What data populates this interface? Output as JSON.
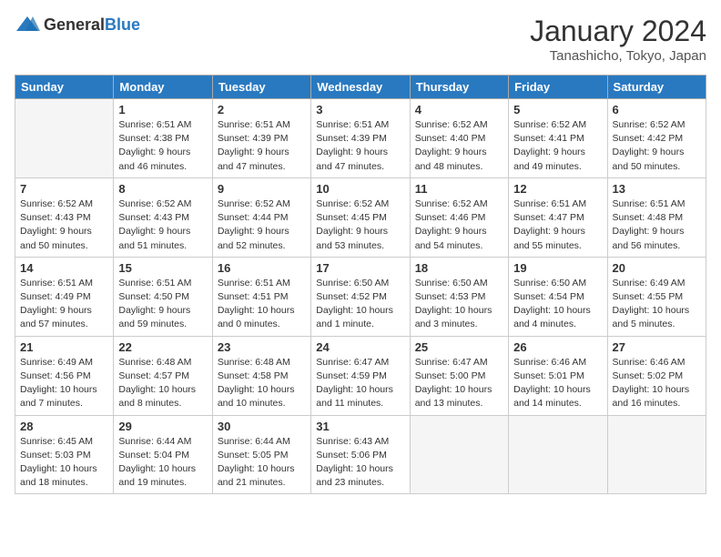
{
  "logo": {
    "general": "General",
    "blue": "Blue"
  },
  "header": {
    "month": "January 2024",
    "location": "Tanashicho, Tokyo, Japan"
  },
  "weekdays": [
    "Sunday",
    "Monday",
    "Tuesday",
    "Wednesday",
    "Thursday",
    "Friday",
    "Saturday"
  ],
  "weeks": [
    [
      {
        "day": "",
        "sunrise": "",
        "sunset": "",
        "daylight": "",
        "empty": true
      },
      {
        "day": "1",
        "sunrise": "Sunrise: 6:51 AM",
        "sunset": "Sunset: 4:38 PM",
        "daylight": "Daylight: 9 hours and 46 minutes."
      },
      {
        "day": "2",
        "sunrise": "Sunrise: 6:51 AM",
        "sunset": "Sunset: 4:39 PM",
        "daylight": "Daylight: 9 hours and 47 minutes."
      },
      {
        "day": "3",
        "sunrise": "Sunrise: 6:51 AM",
        "sunset": "Sunset: 4:39 PM",
        "daylight": "Daylight: 9 hours and 47 minutes."
      },
      {
        "day": "4",
        "sunrise": "Sunrise: 6:52 AM",
        "sunset": "Sunset: 4:40 PM",
        "daylight": "Daylight: 9 hours and 48 minutes."
      },
      {
        "day": "5",
        "sunrise": "Sunrise: 6:52 AM",
        "sunset": "Sunset: 4:41 PM",
        "daylight": "Daylight: 9 hours and 49 minutes."
      },
      {
        "day": "6",
        "sunrise": "Sunrise: 6:52 AM",
        "sunset": "Sunset: 4:42 PM",
        "daylight": "Daylight: 9 hours and 50 minutes."
      }
    ],
    [
      {
        "day": "7",
        "sunrise": "Sunrise: 6:52 AM",
        "sunset": "Sunset: 4:43 PM",
        "daylight": "Daylight: 9 hours and 50 minutes."
      },
      {
        "day": "8",
        "sunrise": "Sunrise: 6:52 AM",
        "sunset": "Sunset: 4:43 PM",
        "daylight": "Daylight: 9 hours and 51 minutes."
      },
      {
        "day": "9",
        "sunrise": "Sunrise: 6:52 AM",
        "sunset": "Sunset: 4:44 PM",
        "daylight": "Daylight: 9 hours and 52 minutes."
      },
      {
        "day": "10",
        "sunrise": "Sunrise: 6:52 AM",
        "sunset": "Sunset: 4:45 PM",
        "daylight": "Daylight: 9 hours and 53 minutes."
      },
      {
        "day": "11",
        "sunrise": "Sunrise: 6:52 AM",
        "sunset": "Sunset: 4:46 PM",
        "daylight": "Daylight: 9 hours and 54 minutes."
      },
      {
        "day": "12",
        "sunrise": "Sunrise: 6:51 AM",
        "sunset": "Sunset: 4:47 PM",
        "daylight": "Daylight: 9 hours and 55 minutes."
      },
      {
        "day": "13",
        "sunrise": "Sunrise: 6:51 AM",
        "sunset": "Sunset: 4:48 PM",
        "daylight": "Daylight: 9 hours and 56 minutes."
      }
    ],
    [
      {
        "day": "14",
        "sunrise": "Sunrise: 6:51 AM",
        "sunset": "Sunset: 4:49 PM",
        "daylight": "Daylight: 9 hours and 57 minutes."
      },
      {
        "day": "15",
        "sunrise": "Sunrise: 6:51 AM",
        "sunset": "Sunset: 4:50 PM",
        "daylight": "Daylight: 9 hours and 59 minutes."
      },
      {
        "day": "16",
        "sunrise": "Sunrise: 6:51 AM",
        "sunset": "Sunset: 4:51 PM",
        "daylight": "Daylight: 10 hours and 0 minutes."
      },
      {
        "day": "17",
        "sunrise": "Sunrise: 6:50 AM",
        "sunset": "Sunset: 4:52 PM",
        "daylight": "Daylight: 10 hours and 1 minute."
      },
      {
        "day": "18",
        "sunrise": "Sunrise: 6:50 AM",
        "sunset": "Sunset: 4:53 PM",
        "daylight": "Daylight: 10 hours and 3 minutes."
      },
      {
        "day": "19",
        "sunrise": "Sunrise: 6:50 AM",
        "sunset": "Sunset: 4:54 PM",
        "daylight": "Daylight: 10 hours and 4 minutes."
      },
      {
        "day": "20",
        "sunrise": "Sunrise: 6:49 AM",
        "sunset": "Sunset: 4:55 PM",
        "daylight": "Daylight: 10 hours and 5 minutes."
      }
    ],
    [
      {
        "day": "21",
        "sunrise": "Sunrise: 6:49 AM",
        "sunset": "Sunset: 4:56 PM",
        "daylight": "Daylight: 10 hours and 7 minutes."
      },
      {
        "day": "22",
        "sunrise": "Sunrise: 6:48 AM",
        "sunset": "Sunset: 4:57 PM",
        "daylight": "Daylight: 10 hours and 8 minutes."
      },
      {
        "day": "23",
        "sunrise": "Sunrise: 6:48 AM",
        "sunset": "Sunset: 4:58 PM",
        "daylight": "Daylight: 10 hours and 10 minutes."
      },
      {
        "day": "24",
        "sunrise": "Sunrise: 6:47 AM",
        "sunset": "Sunset: 4:59 PM",
        "daylight": "Daylight: 10 hours and 11 minutes."
      },
      {
        "day": "25",
        "sunrise": "Sunrise: 6:47 AM",
        "sunset": "Sunset: 5:00 PM",
        "daylight": "Daylight: 10 hours and 13 minutes."
      },
      {
        "day": "26",
        "sunrise": "Sunrise: 6:46 AM",
        "sunset": "Sunset: 5:01 PM",
        "daylight": "Daylight: 10 hours and 14 minutes."
      },
      {
        "day": "27",
        "sunrise": "Sunrise: 6:46 AM",
        "sunset": "Sunset: 5:02 PM",
        "daylight": "Daylight: 10 hours and 16 minutes."
      }
    ],
    [
      {
        "day": "28",
        "sunrise": "Sunrise: 6:45 AM",
        "sunset": "Sunset: 5:03 PM",
        "daylight": "Daylight: 10 hours and 18 minutes."
      },
      {
        "day": "29",
        "sunrise": "Sunrise: 6:44 AM",
        "sunset": "Sunset: 5:04 PM",
        "daylight": "Daylight: 10 hours and 19 minutes."
      },
      {
        "day": "30",
        "sunrise": "Sunrise: 6:44 AM",
        "sunset": "Sunset: 5:05 PM",
        "daylight": "Daylight: 10 hours and 21 minutes."
      },
      {
        "day": "31",
        "sunrise": "Sunrise: 6:43 AM",
        "sunset": "Sunset: 5:06 PM",
        "daylight": "Daylight: 10 hours and 23 minutes."
      },
      {
        "day": "",
        "sunrise": "",
        "sunset": "",
        "daylight": "",
        "empty": true
      },
      {
        "day": "",
        "sunrise": "",
        "sunset": "",
        "daylight": "",
        "empty": true
      },
      {
        "day": "",
        "sunrise": "",
        "sunset": "",
        "daylight": "",
        "empty": true
      }
    ]
  ]
}
